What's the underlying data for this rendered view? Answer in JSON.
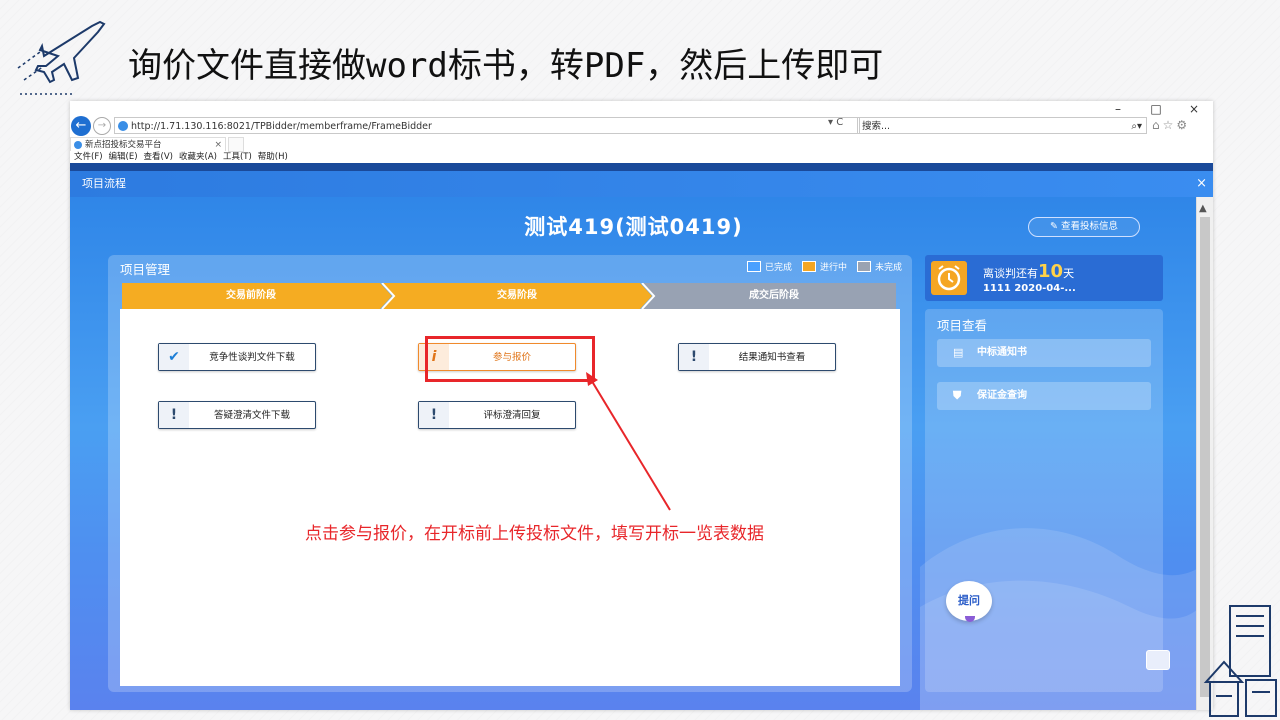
{
  "slide": {
    "title": "询价文件直接做word标书，转PDF，然后上传即可",
    "annotation": "点击参与报价，在开标前上传投标文件，填写开标一览表数据"
  },
  "browser": {
    "window_controls": [
      "–",
      "□",
      "×"
    ],
    "address": "http://1.71.130.116:8021/TPBidder/memberframe/FrameBidder",
    "address_tools": "▾ C",
    "search_placeholder": "搜索...",
    "tab_title": "新点招投标交易平台",
    "tab_close": "×",
    "menu": [
      "文件(F)",
      "编辑(E)",
      "查看(V)",
      "收藏夹(A)",
      "工具(T)",
      "帮助(H)"
    ]
  },
  "dialog": {
    "title": "项目流程",
    "close": "×"
  },
  "project": {
    "title": "测试419(测试0419)",
    "bid_info_button": "查看投标信息"
  },
  "management": {
    "title": "项目管理",
    "legend": [
      {
        "label": "已完成",
        "color": "#4aa0ff"
      },
      {
        "label": "进行中",
        "color": "#f5a623"
      },
      {
        "label": "未完成",
        "color": "#9aa3b2"
      }
    ],
    "stages": [
      {
        "label": "交易前阶段",
        "color": "#f5ac22"
      },
      {
        "label": "交易阶段",
        "color": "#f5ac22"
      },
      {
        "label": "成交后阶段",
        "color": "#98a2b3"
      }
    ],
    "actions": [
      {
        "label": "竞争性谈判文件下载",
        "icon": "✔"
      },
      {
        "label": "参与报价",
        "icon": "i"
      },
      {
        "label": "结果通知书查看",
        "icon": "!"
      },
      {
        "label": "答疑澄清文件下载",
        "icon": "!"
      },
      {
        "label": "评标澄清回复",
        "icon": "!"
      }
    ]
  },
  "countdown": {
    "prefix": "离谈判还有",
    "days": "10",
    "suffix": "天",
    "detail": "1111 2020-04-..."
  },
  "view_panel": {
    "title": "项目查看",
    "items": [
      {
        "label": "中标通知书",
        "icon": "▤"
      },
      {
        "label": "保证金查询",
        "icon": "⛊"
      }
    ]
  },
  "ask_button": "提问"
}
